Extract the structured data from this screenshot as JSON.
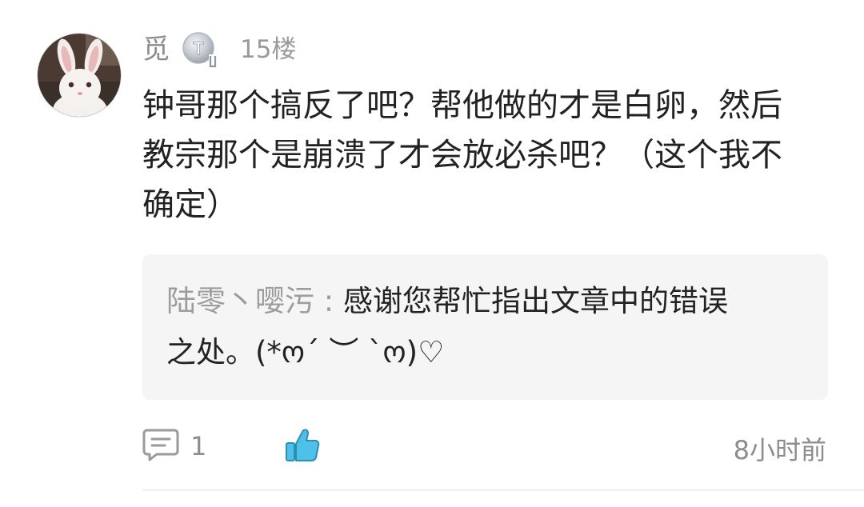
{
  "comment": {
    "username": "觅",
    "badge_letter": "T",
    "floor": "15楼",
    "content_lines": [
      "钟哥那个搞反了吧？帮他做的才是白卵，然后",
      "教宗那个是崩溃了才会放必杀吧？（这个我不",
      "确定）"
    ],
    "reply": {
      "author": "陆零丶嘤污",
      "separator": " : ",
      "text_line1": "感谢您帮忙指出文章中的错误",
      "text_line2": "之处。(*ო´ ︶ `ო)♡"
    },
    "actions": {
      "comment_icon": "comment-bubble-icon",
      "comment_count": "1",
      "like_icon": "thumbs-up-icon",
      "timestamp": "8小时前"
    },
    "colors": {
      "accent_like": "#4fc0e8",
      "muted_text": "#8c8c8c",
      "reply_bg": "#f5f5f5"
    }
  }
}
